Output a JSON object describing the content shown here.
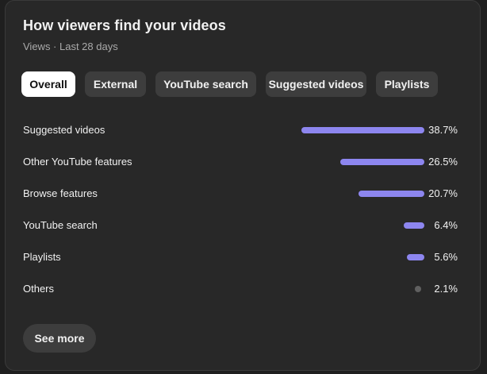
{
  "card": {
    "title": "How viewers find your videos",
    "subtitle": "Views · Last 28 days"
  },
  "tabs": [
    {
      "label": "Overall",
      "active": true
    },
    {
      "label": "External",
      "active": false
    },
    {
      "label": "YouTube search",
      "active": false
    },
    {
      "label": "Suggested videos",
      "active": false
    },
    {
      "label": "Playlists",
      "active": false
    }
  ],
  "sources": [
    {
      "label": "Suggested videos",
      "value_text": "38.7%",
      "share": 38.7,
      "marker": "bar"
    },
    {
      "label": "Other YouTube features",
      "value_text": "26.5%",
      "share": 26.5,
      "marker": "bar"
    },
    {
      "label": "Browse features",
      "value_text": "20.7%",
      "share": 20.7,
      "marker": "bar"
    },
    {
      "label": "YouTube search",
      "value_text": "6.4%",
      "share": 6.4,
      "marker": "bar"
    },
    {
      "label": "Playlists",
      "value_text": "5.6%",
      "share": 5.6,
      "marker": "bar"
    },
    {
      "label": "Others",
      "value_text": "2.1%",
      "share": 2.1,
      "marker": "dot"
    }
  ],
  "see_more_label": "See more",
  "colors": {
    "bar": "#8d86ef",
    "dot": "#606060",
    "card_bg": "#282828",
    "chip_bg": "#3d3d3d",
    "active_chip_bg": "#ffffff"
  }
}
